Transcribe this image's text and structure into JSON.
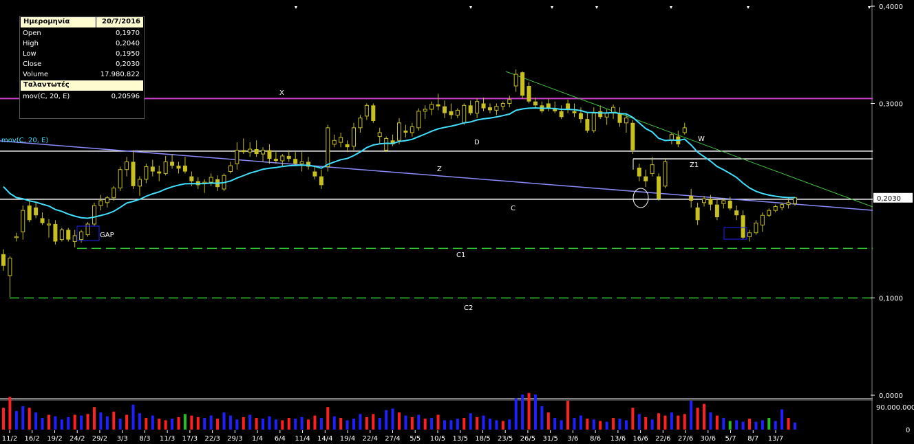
{
  "info_panel": {
    "date_label": "Ημερομηνία",
    "date_value": "20/7/2016",
    "rows": [
      {
        "label": "Open",
        "value": "0,1970"
      },
      {
        "label": "High",
        "value": "0,2040"
      },
      {
        "label": "Low",
        "value": "0,1950"
      },
      {
        "label": "Close",
        "value": "0,2030"
      },
      {
        "label": "Volume",
        "value": "17.980.822"
      }
    ],
    "indicators_label": "Ταλαντωτές",
    "indicator_name": "mov(C, 20, E)",
    "indicator_value": "0,20596"
  },
  "chart_data": {
    "type": "candlestick",
    "price_axis_labels": [
      "0,4000",
      "0,3000",
      "0,1000",
      "0,0000"
    ],
    "last_price_label": "0,2030",
    "volume_axis_labels": [
      "90.000.000",
      "0"
    ],
    "x_tick_labels": [
      "11/2",
      "16/2",
      "19/2",
      "24/2",
      "29/2",
      "3/3",
      "8/3",
      "11/3",
      "17/3",
      "22/3",
      "29/3",
      "1/4",
      "6/4",
      "11/4",
      "14/4",
      "19/4",
      "22/4",
      "27/4",
      "5/5",
      "10/5",
      "13/5",
      "18/5",
      "23/5",
      "26/5",
      "31/5",
      "3/6",
      "8/6",
      "13/6",
      "16/6",
      "22/6",
      "27/6",
      "30/6",
      "5/7",
      "8/7",
      "13/7"
    ],
    "ma_label": "mov(C, 20, E)",
    "ylim": [
      0,
      0.4
    ],
    "annotations": [
      "X",
      "D",
      "Z",
      "W",
      "Z1",
      "C",
      "C1",
      "C2",
      "GAP"
    ],
    "horizontal_levels": [
      {
        "label": "X",
        "value": 0.305,
        "color": "#d040d0",
        "style": "solid"
      },
      {
        "label": "D",
        "value": 0.251,
        "color": "#ffffff",
        "style": "solid"
      },
      {
        "label": "Z1",
        "value": 0.243,
        "color": "#ffffff",
        "style": "solid"
      },
      {
        "label": "C",
        "value": 0.2015,
        "color": "#ffffff",
        "style": "solid"
      },
      {
        "label": "C1",
        "value": 0.151,
        "color": "#33cc33",
        "style": "dashed"
      },
      {
        "label": "C2",
        "value": 0.1,
        "color": "#33cc33",
        "style": "dashed"
      }
    ],
    "candles": [
      {
        "o": 0.145,
        "h": 0.15,
        "l": 0.128,
        "c": 0.133,
        "v": 28
      },
      {
        "o": 0.123,
        "h": 0.143,
        "l": 0.101,
        "c": 0.141,
        "v": 42
      },
      {
        "o": 0.162,
        "h": 0.167,
        "l": 0.158,
        "c": 0.163,
        "v": 24
      },
      {
        "o": 0.168,
        "h": 0.195,
        "l": 0.16,
        "c": 0.19,
        "v": 30
      },
      {
        "o": 0.195,
        "h": 0.2,
        "l": 0.178,
        "c": 0.18,
        "v": 28
      },
      {
        "o": 0.193,
        "h": 0.198,
        "l": 0.182,
        "c": 0.185,
        "v": 22
      },
      {
        "o": 0.182,
        "h": 0.188,
        "l": 0.175,
        "c": 0.177,
        "v": 15
      },
      {
        "o": 0.175,
        "h": 0.181,
        "l": 0.162,
        "c": 0.176,
        "v": 19
      },
      {
        "o": 0.176,
        "h": 0.18,
        "l": 0.155,
        "c": 0.158,
        "v": 17
      },
      {
        "o": 0.16,
        "h": 0.172,
        "l": 0.158,
        "c": 0.17,
        "v": 13
      },
      {
        "o": 0.17,
        "h": 0.172,
        "l": 0.158,
        "c": 0.16,
        "v": 16
      },
      {
        "o": 0.158,
        "h": 0.17,
        "l": 0.152,
        "c": 0.164,
        "v": 19
      },
      {
        "o": 0.16,
        "h": 0.17,
        "l": 0.157,
        "c": 0.168,
        "v": 18
      },
      {
        "o": 0.165,
        "h": 0.178,
        "l": 0.163,
        "c": 0.176,
        "v": 20
      },
      {
        "o": 0.176,
        "h": 0.198,
        "l": 0.174,
        "c": 0.195,
        "v": 29
      },
      {
        "o": 0.195,
        "h": 0.206,
        "l": 0.19,
        "c": 0.2,
        "v": 22
      },
      {
        "o": 0.198,
        "h": 0.205,
        "l": 0.193,
        "c": 0.203,
        "v": 17
      },
      {
        "o": 0.203,
        "h": 0.215,
        "l": 0.2,
        "c": 0.213,
        "v": 23
      },
      {
        "o": 0.213,
        "h": 0.235,
        "l": 0.21,
        "c": 0.232,
        "v": 14
      },
      {
        "o": 0.232,
        "h": 0.245,
        "l": 0.225,
        "c": 0.24,
        "v": 19
      },
      {
        "o": 0.24,
        "h": 0.252,
        "l": 0.212,
        "c": 0.215,
        "v": 32
      },
      {
        "o": 0.215,
        "h": 0.225,
        "l": 0.205,
        "c": 0.222,
        "v": 21
      },
      {
        "o": 0.222,
        "h": 0.238,
        "l": 0.218,
        "c": 0.235,
        "v": 15
      },
      {
        "o": 0.235,
        "h": 0.242,
        "l": 0.225,
        "c": 0.23,
        "v": 18
      },
      {
        "o": 0.23,
        "h": 0.236,
        "l": 0.22,
        "c": 0.228,
        "v": 14
      },
      {
        "o": 0.228,
        "h": 0.246,
        "l": 0.226,
        "c": 0.24,
        "v": 12
      },
      {
        "o": 0.24,
        "h": 0.248,
        "l": 0.233,
        "c": 0.236,
        "v": 14
      },
      {
        "o": 0.236,
        "h": 0.24,
        "l": 0.228,
        "c": 0.233,
        "v": 16
      },
      {
        "o": 0.236,
        "h": 0.245,
        "l": 0.228,
        "c": 0.23,
        "v": 20
      },
      {
        "o": 0.225,
        "h": 0.23,
        "l": 0.215,
        "c": 0.22,
        "v": 18
      },
      {
        "o": 0.22,
        "h": 0.224,
        "l": 0.212,
        "c": 0.216,
        "v": 16
      },
      {
        "o": 0.218,
        "h": 0.222,
        "l": 0.208,
        "c": 0.219,
        "v": 15
      },
      {
        "o": 0.219,
        "h": 0.228,
        "l": 0.215,
        "c": 0.224,
        "v": 18
      },
      {
        "o": 0.222,
        "h": 0.226,
        "l": 0.21,
        "c": 0.214,
        "v": 14
      },
      {
        "o": 0.212,
        "h": 0.228,
        "l": 0.21,
        "c": 0.226,
        "v": 22
      },
      {
        "o": 0.23,
        "h": 0.24,
        "l": 0.228,
        "c": 0.236,
        "v": 18
      },
      {
        "o": 0.238,
        "h": 0.26,
        "l": 0.232,
        "c": 0.252,
        "v": 13
      },
      {
        "o": 0.252,
        "h": 0.264,
        "l": 0.248,
        "c": 0.25,
        "v": 16
      },
      {
        "o": 0.25,
        "h": 0.26,
        "l": 0.245,
        "c": 0.253,
        "v": 19
      },
      {
        "o": 0.253,
        "h": 0.262,
        "l": 0.245,
        "c": 0.248,
        "v": 15
      },
      {
        "o": 0.248,
        "h": 0.255,
        "l": 0.24,
        "c": 0.252,
        "v": 14
      },
      {
        "o": 0.252,
        "h": 0.258,
        "l": 0.238,
        "c": 0.243,
        "v": 17
      },
      {
        "o": 0.243,
        "h": 0.25,
        "l": 0.238,
        "c": 0.241,
        "v": 13
      },
      {
        "o": 0.241,
        "h": 0.248,
        "l": 0.236,
        "c": 0.246,
        "v": 12
      },
      {
        "o": 0.246,
        "h": 0.252,
        "l": 0.24,
        "c": 0.243,
        "v": 15
      },
      {
        "o": 0.243,
        "h": 0.25,
        "l": 0.236,
        "c": 0.238,
        "v": 14
      },
      {
        "o": 0.238,
        "h": 0.25,
        "l": 0.23,
        "c": 0.24,
        "v": 16
      },
      {
        "o": 0.24,
        "h": 0.245,
        "l": 0.232,
        "c": 0.235,
        "v": 13
      },
      {
        "o": 0.23,
        "h": 0.236,
        "l": 0.222,
        "c": 0.225,
        "v": 18
      },
      {
        "o": 0.225,
        "h": 0.232,
        "l": 0.212,
        "c": 0.216,
        "v": 15
      },
      {
        "o": 0.235,
        "h": 0.278,
        "l": 0.23,
        "c": 0.275,
        "v": 29
      },
      {
        "o": 0.258,
        "h": 0.268,
        "l": 0.255,
        "c": 0.262,
        "v": 17
      },
      {
        "o": 0.26,
        "h": 0.27,
        "l": 0.255,
        "c": 0.265,
        "v": 15
      },
      {
        "o": 0.258,
        "h": 0.262,
        "l": 0.25,
        "c": 0.255,
        "v": 12
      },
      {
        "o": 0.256,
        "h": 0.28,
        "l": 0.252,
        "c": 0.275,
        "v": 14
      },
      {
        "o": 0.275,
        "h": 0.288,
        "l": 0.27,
        "c": 0.285,
        "v": 20
      },
      {
        "o": 0.287,
        "h": 0.3,
        "l": 0.283,
        "c": 0.298,
        "v": 16
      },
      {
        "o": 0.298,
        "h": 0.3,
        "l": 0.28,
        "c": 0.282,
        "v": 20
      },
      {
        "o": 0.266,
        "h": 0.275,
        "l": 0.258,
        "c": 0.27,
        "v": 15
      },
      {
        "o": 0.252,
        "h": 0.266,
        "l": 0.25,
        "c": 0.264,
        "v": 25
      },
      {
        "o": 0.262,
        "h": 0.268,
        "l": 0.256,
        "c": 0.258,
        "v": 27
      },
      {
        "o": 0.262,
        "h": 0.285,
        "l": 0.258,
        "c": 0.28,
        "v": 22
      },
      {
        "o": 0.272,
        "h": 0.278,
        "l": 0.265,
        "c": 0.27,
        "v": 18
      },
      {
        "o": 0.27,
        "h": 0.28,
        "l": 0.266,
        "c": 0.276,
        "v": 16
      },
      {
        "o": 0.275,
        "h": 0.295,
        "l": 0.272,
        "c": 0.292,
        "v": 19
      },
      {
        "o": 0.292,
        "h": 0.298,
        "l": 0.284,
        "c": 0.294,
        "v": 14
      },
      {
        "o": 0.294,
        "h": 0.302,
        "l": 0.288,
        "c": 0.299,
        "v": 15
      },
      {
        "o": 0.299,
        "h": 0.31,
        "l": 0.293,
        "c": 0.297,
        "v": 19
      },
      {
        "o": 0.297,
        "h": 0.303,
        "l": 0.285,
        "c": 0.29,
        "v": 12
      },
      {
        "o": 0.292,
        "h": 0.3,
        "l": 0.284,
        "c": 0.288,
        "v": 12
      },
      {
        "o": 0.288,
        "h": 0.295,
        "l": 0.285,
        "c": 0.293,
        "v": 14
      },
      {
        "o": 0.28,
        "h": 0.3,
        "l": 0.278,
        "c": 0.298,
        "v": 15
      },
      {
        "o": 0.298,
        "h": 0.303,
        "l": 0.288,
        "c": 0.29,
        "v": 21
      },
      {
        "o": 0.29,
        "h": 0.305,
        "l": 0.285,
        "c": 0.302,
        "v": 16
      },
      {
        "o": 0.3,
        "h": 0.306,
        "l": 0.292,
        "c": 0.295,
        "v": 18
      },
      {
        "o": 0.296,
        "h": 0.3,
        "l": 0.29,
        "c": 0.293,
        "v": 14
      },
      {
        "o": 0.293,
        "h": 0.3,
        "l": 0.288,
        "c": 0.297,
        "v": 12
      },
      {
        "o": 0.297,
        "h": 0.302,
        "l": 0.293,
        "c": 0.3,
        "v": 11
      },
      {
        "o": 0.3,
        "h": 0.308,
        "l": 0.296,
        "c": 0.304,
        "v": 13
      },
      {
        "o": 0.318,
        "h": 0.335,
        "l": 0.312,
        "c": 0.33,
        "v": 40
      },
      {
        "o": 0.332,
        "h": 0.333,
        "l": 0.305,
        "c": 0.308,
        "v": 45
      },
      {
        "o": 0.318,
        "h": 0.322,
        "l": 0.3,
        "c": 0.302,
        "v": 47
      },
      {
        "o": 0.302,
        "h": 0.306,
        "l": 0.296,
        "c": 0.298,
        "v": 45
      },
      {
        "o": 0.298,
        "h": 0.302,
        "l": 0.29,
        "c": 0.292,
        "v": 30
      },
      {
        "o": 0.3,
        "h": 0.305,
        "l": 0.292,
        "c": 0.295,
        "v": 22
      },
      {
        "o": 0.295,
        "h": 0.302,
        "l": 0.29,
        "c": 0.292,
        "v": 15
      },
      {
        "o": 0.292,
        "h": 0.298,
        "l": 0.284,
        "c": 0.286,
        "v": 12
      },
      {
        "o": 0.3,
        "h": 0.304,
        "l": 0.29,
        "c": 0.294,
        "v": 37
      },
      {
        "o": 0.292,
        "h": 0.3,
        "l": 0.286,
        "c": 0.29,
        "v": 15
      },
      {
        "o": 0.29,
        "h": 0.296,
        "l": 0.28,
        "c": 0.284,
        "v": 18
      },
      {
        "o": 0.284,
        "h": 0.29,
        "l": 0.27,
        "c": 0.272,
        "v": 14
      },
      {
        "o": 0.272,
        "h": 0.296,
        "l": 0.27,
        "c": 0.29,
        "v": 13
      },
      {
        "o": 0.292,
        "h": 0.298,
        "l": 0.284,
        "c": 0.286,
        "v": 11
      },
      {
        "o": 0.286,
        "h": 0.294,
        "l": 0.278,
        "c": 0.29,
        "v": 10
      },
      {
        "o": 0.29,
        "h": 0.299,
        "l": 0.284,
        "c": 0.296,
        "v": 15
      },
      {
        "o": 0.29,
        "h": 0.296,
        "l": 0.276,
        "c": 0.28,
        "v": 14
      },
      {
        "o": 0.28,
        "h": 0.29,
        "l": 0.27,
        "c": 0.285,
        "v": 12
      },
      {
        "o": 0.28,
        "h": 0.283,
        "l": 0.248,
        "c": 0.252,
        "v": 28
      },
      {
        "o": 0.234,
        "h": 0.238,
        "l": 0.22,
        "c": 0.225,
        "v": 20
      },
      {
        "o": 0.225,
        "h": 0.232,
        "l": 0.214,
        "c": 0.22,
        "v": 16
      },
      {
        "o": 0.228,
        "h": 0.245,
        "l": 0.225,
        "c": 0.237,
        "v": 13
      },
      {
        "o": 0.225,
        "h": 0.228,
        "l": 0.2,
        "c": 0.202,
        "v": 21
      },
      {
        "o": 0.215,
        "h": 0.243,
        "l": 0.213,
        "c": 0.24,
        "v": 18
      },
      {
        "o": 0.262,
        "h": 0.27,
        "l": 0.258,
        "c": 0.268,
        "v": 22
      },
      {
        "o": 0.266,
        "h": 0.272,
        "l": 0.255,
        "c": 0.258,
        "v": 18
      },
      {
        "o": 0.27,
        "h": 0.28,
        "l": 0.268,
        "c": 0.275,
        "v": 20
      },
      {
        "o": 0.205,
        "h": 0.212,
        "l": 0.193,
        "c": 0.2,
        "v": 37
      },
      {
        "o": 0.193,
        "h": 0.198,
        "l": 0.175,
        "c": 0.18,
        "v": 28
      },
      {
        "o": 0.198,
        "h": 0.205,
        "l": 0.194,
        "c": 0.202,
        "v": 33
      },
      {
        "o": 0.202,
        "h": 0.206,
        "l": 0.19,
        "c": 0.196,
        "v": 22
      },
      {
        "o": 0.196,
        "h": 0.202,
        "l": 0.18,
        "c": 0.183,
        "v": 18
      },
      {
        "o": 0.197,
        "h": 0.203,
        "l": 0.192,
        "c": 0.2,
        "v": 15
      },
      {
        "o": 0.2,
        "h": 0.204,
        "l": 0.19,
        "c": 0.192,
        "v": 11
      },
      {
        "o": 0.19,
        "h": 0.195,
        "l": 0.18,
        "c": 0.185,
        "v": 12
      },
      {
        "o": 0.185,
        "h": 0.19,
        "l": 0.16,
        "c": 0.162,
        "v": 10
      },
      {
        "o": 0.163,
        "h": 0.17,
        "l": 0.158,
        "c": 0.167,
        "v": 14
      },
      {
        "o": 0.167,
        "h": 0.18,
        "l": 0.165,
        "c": 0.177,
        "v": 10
      },
      {
        "o": 0.175,
        "h": 0.188,
        "l": 0.168,
        "c": 0.185,
        "v": 12
      },
      {
        "o": 0.185,
        "h": 0.192,
        "l": 0.183,
        "c": 0.19,
        "v": 15
      },
      {
        "o": 0.19,
        "h": 0.196,
        "l": 0.188,
        "c": 0.194,
        "v": 11
      },
      {
        "o": 0.193,
        "h": 0.198,
        "l": 0.19,
        "c": 0.196,
        "v": 26
      },
      {
        "o": 0.196,
        "h": 0.203,
        "l": 0.192,
        "c": 0.198,
        "v": 15
      },
      {
        "o": 0.197,
        "h": 0.204,
        "l": 0.195,
        "c": 0.203,
        "v": 9
      }
    ],
    "volume_colors": [
      "r",
      "r",
      "b",
      "b",
      "r",
      "b",
      "b",
      "r",
      "b",
      "b",
      "b",
      "r",
      "b",
      "r",
      "r",
      "b",
      "b",
      "r",
      "b",
      "r",
      "b",
      "b",
      "r",
      "b",
      "r",
      "r",
      "b",
      "r",
      "g",
      "r",
      "r",
      "b",
      "b",
      "r",
      "b",
      "b",
      "b",
      "r",
      "b",
      "r",
      "b",
      "b",
      "b",
      "r",
      "r",
      "b",
      "b",
      "r",
      "r",
      "b",
      "r",
      "b",
      "r",
      "b",
      "b",
      "b",
      "r",
      "r",
      "b",
      "b",
      "b",
      "r",
      "b",
      "r",
      "b",
      "r",
      "b",
      "r",
      "b",
      "b",
      "b",
      "r",
      "b",
      "r",
      "b",
      "b",
      "b",
      "r",
      "b",
      "b",
      "b",
      "r",
      "b",
      "b",
      "r",
      "b",
      "b",
      "r",
      "b",
      "b",
      "r",
      "b",
      "r",
      "b",
      "r",
      "b",
      "b",
      "r",
      "b",
      "r",
      "b",
      "r",
      "r",
      "b",
      "r",
      "r",
      "b",
      "r",
      "r",
      "b",
      "r",
      "b",
      "g",
      "b",
      "b",
      "r",
      "b",
      "b",
      "g",
      "b",
      "b",
      "r",
      "b",
      "b"
    ],
    "colors": {
      "candle": "#c8c020",
      "ma": "#40e0ff",
      "trend_blue": "#8c8cff",
      "trend_green": "#40c040",
      "level_x": "#d040d0",
      "vol_red": "#ff2020",
      "vol_blue": "#2020ff",
      "vol_green": "#20c020"
    }
  }
}
